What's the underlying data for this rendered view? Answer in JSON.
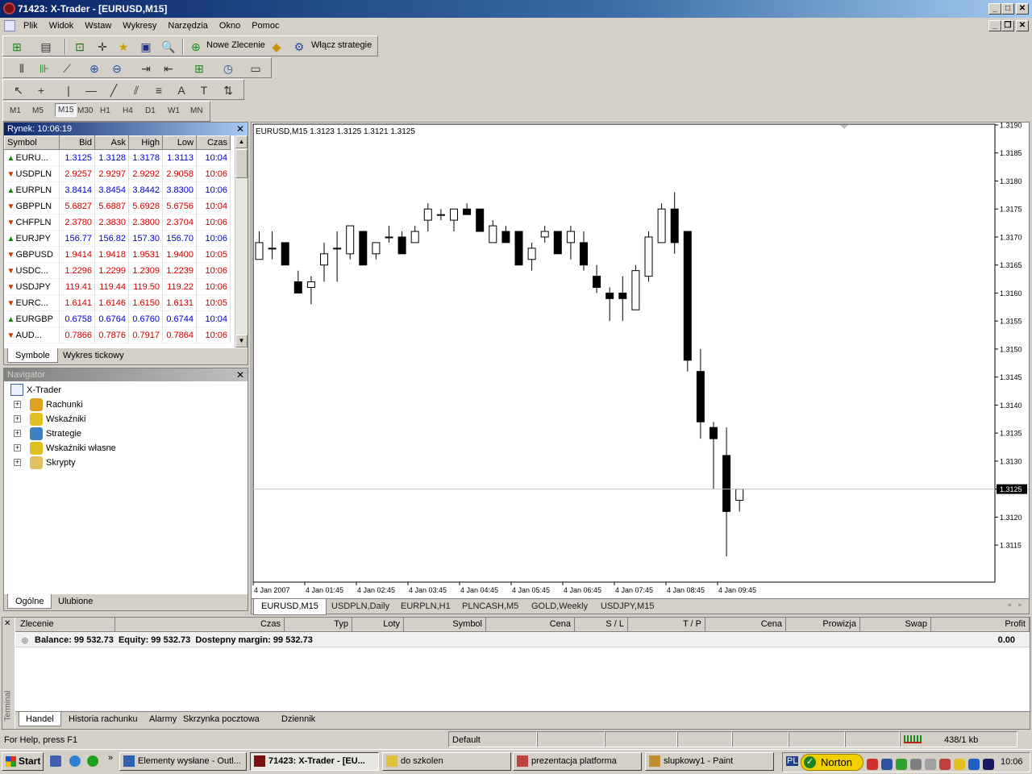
{
  "window": {
    "title": "71423: X-Trader - [EURUSD,M15]"
  },
  "menu": [
    "Plik",
    "Widok",
    "Wstaw",
    "Wykresy",
    "Narzędzia",
    "Okno",
    "Pomoc"
  ],
  "toolbar": {
    "new_order": "Nowe Zlecenie",
    "enable_strategies": "Włącz strategie"
  },
  "timeframes": [
    "M1",
    "M5",
    "M15",
    "M30",
    "H1",
    "H4",
    "D1",
    "W1",
    "MN"
  ],
  "active_timeframe": "M15",
  "market_watch": {
    "title": "Rynek: 10:06:19",
    "columns": [
      "Symbol",
      "Bid",
      "Ask",
      "High",
      "Low",
      "Czas"
    ],
    "rows": [
      {
        "symbol": "EURU...",
        "bid": "1.3125",
        "ask": "1.3128",
        "high": "1.3178",
        "low": "1.3113",
        "time": "10:04",
        "dir": "up"
      },
      {
        "symbol": "USDPLN",
        "bid": "2.9257",
        "ask": "2.9297",
        "high": "2.9292",
        "low": "2.9058",
        "time": "10:06",
        "dir": "down"
      },
      {
        "symbol": "EURPLN",
        "bid": "3.8414",
        "ask": "3.8454",
        "high": "3.8442",
        "low": "3.8300",
        "time": "10:06",
        "dir": "up"
      },
      {
        "symbol": "GBPPLN",
        "bid": "5.6827",
        "ask": "5.6887",
        "high": "5.6928",
        "low": "5.6756",
        "time": "10:04",
        "dir": "down"
      },
      {
        "symbol": "CHFPLN",
        "bid": "2.3780",
        "ask": "2.3830",
        "high": "2.3800",
        "low": "2.3704",
        "time": "10:06",
        "dir": "down"
      },
      {
        "symbol": "EURJPY",
        "bid": "156.77",
        "ask": "156.82",
        "high": "157.30",
        "low": "156.70",
        "time": "10:06",
        "dir": "up"
      },
      {
        "symbol": "GBPUSD",
        "bid": "1.9414",
        "ask": "1.9418",
        "high": "1.9531",
        "low": "1.9400",
        "time": "10:05",
        "dir": "down"
      },
      {
        "symbol": "USDC...",
        "bid": "1.2296",
        "ask": "1.2299",
        "high": "1.2309",
        "low": "1.2239",
        "time": "10:06",
        "dir": "down"
      },
      {
        "symbol": "USDJPY",
        "bid": "119.41",
        "ask": "119.44",
        "high": "119.50",
        "low": "119.22",
        "time": "10:06",
        "dir": "down"
      },
      {
        "symbol": "EURC...",
        "bid": "1.6141",
        "ask": "1.6146",
        "high": "1.6150",
        "low": "1.6131",
        "time": "10:05",
        "dir": "down"
      },
      {
        "symbol": "EURGBP",
        "bid": "0.6758",
        "ask": "0.6764",
        "high": "0.6760",
        "low": "0.6744",
        "time": "10:04",
        "dir": "up"
      },
      {
        "symbol": "AUD...",
        "bid": "0.7866",
        "ask": "0.7876",
        "high": "0.7917",
        "low": "0.7864",
        "time": "10:06",
        "dir": "down"
      }
    ],
    "tabs": [
      "Symbole",
      "Wykres tickowy"
    ]
  },
  "navigator": {
    "title": "Navigator",
    "root": "X-Trader",
    "items": [
      "Rachunki",
      "Wskaźniki",
      "Strategie",
      "Wskaźniki własne",
      "Skrypty"
    ],
    "tabs": [
      "Ogólne",
      "Ulubione"
    ]
  },
  "chart": {
    "header": "EURUSD,M15  1.3123 1.3125 1.3121 1.3125",
    "tabs": [
      "EURUSD,M15",
      "USDPLN,Daily",
      "EURPLN,H1",
      "PLNCASH,M5",
      "GOLD,Weekly",
      "USDJPY,M15"
    ],
    "active_tab": "EURUSD,M15",
    "current_price_label": "1.3125"
  },
  "chart_data": {
    "type": "candlestick",
    "symbol": "EURUSD",
    "timeframe": "M15",
    "current_price": 1.3125,
    "ylim": [
      1.3113,
      1.319
    ],
    "y_ticks": [
      "1.3190",
      "1.3185",
      "1.3180",
      "1.3175",
      "1.3170",
      "1.3165",
      "1.3160",
      "1.3155",
      "1.3150",
      "1.3145",
      "1.3140",
      "1.3135",
      "1.3130",
      "1.3125",
      "1.3120",
      "1.3115"
    ],
    "x_ticks": [
      "4 Jan 2007",
      "4 Jan 01:45",
      "4 Jan 02:45",
      "4 Jan 03:45",
      "4 Jan 04:45",
      "4 Jan 05:45",
      "4 Jan 06:45",
      "4 Jan 07:45",
      "4 Jan 08:45",
      "4 Jan 09:45"
    ],
    "candles": [
      {
        "o": 1.3166,
        "h": 1.3171,
        "l": 1.3166,
        "c": 1.3169
      },
      {
        "o": 1.3168,
        "h": 1.3171,
        "l": 1.3166,
        "c": 1.3168
      },
      {
        "o": 1.3169,
        "h": 1.3169,
        "l": 1.3165,
        "c": 1.3165
      },
      {
        "o": 1.3162,
        "h": 1.3164,
        "l": 1.316,
        "c": 1.316
      },
      {
        "o": 1.3161,
        "h": 1.3163,
        "l": 1.3158,
        "c": 1.3162
      },
      {
        "o": 1.3165,
        "h": 1.3169,
        "l": 1.3162,
        "c": 1.3167
      },
      {
        "o": 1.3168,
        "h": 1.3171,
        "l": 1.3162,
        "c": 1.3168
      },
      {
        "o": 1.3167,
        "h": 1.3172,
        "l": 1.3166,
        "c": 1.3172
      },
      {
        "o": 1.3171,
        "h": 1.3171,
        "l": 1.3165,
        "c": 1.3165
      },
      {
        "o": 1.3167,
        "h": 1.3169,
        "l": 1.3166,
        "c": 1.3169
      },
      {
        "o": 1.317,
        "h": 1.3172,
        "l": 1.3169,
        "c": 1.317
      },
      {
        "o": 1.317,
        "h": 1.3171,
        "l": 1.3167,
        "c": 1.3167
      },
      {
        "o": 1.3169,
        "h": 1.3172,
        "l": 1.3169,
        "c": 1.3171
      },
      {
        "o": 1.3173,
        "h": 1.3176,
        "l": 1.3171,
        "c": 1.3175
      },
      {
        "o": 1.3174,
        "h": 1.3175,
        "l": 1.3173,
        "c": 1.3174
      },
      {
        "o": 1.3173,
        "h": 1.3175,
        "l": 1.3171,
        "c": 1.3175
      },
      {
        "o": 1.3175,
        "h": 1.3176,
        "l": 1.3174,
        "c": 1.3174
      },
      {
        "o": 1.3175,
        "h": 1.3175,
        "l": 1.3171,
        "c": 1.3171
      },
      {
        "o": 1.3169,
        "h": 1.3173,
        "l": 1.3169,
        "c": 1.3172
      },
      {
        "o": 1.3171,
        "h": 1.3172,
        "l": 1.3169,
        "c": 1.3169
      },
      {
        "o": 1.3171,
        "h": 1.3171,
        "l": 1.3165,
        "c": 1.3165
      },
      {
        "o": 1.3166,
        "h": 1.3169,
        "l": 1.3164,
        "c": 1.3168
      },
      {
        "o": 1.317,
        "h": 1.3172,
        "l": 1.3169,
        "c": 1.3171
      },
      {
        "o": 1.3171,
        "h": 1.3171,
        "l": 1.3167,
        "c": 1.3167
      },
      {
        "o": 1.3169,
        "h": 1.3172,
        "l": 1.3166,
        "c": 1.3171
      },
      {
        "o": 1.3169,
        "h": 1.3171,
        "l": 1.3164,
        "c": 1.3165
      },
      {
        "o": 1.3163,
        "h": 1.3165,
        "l": 1.316,
        "c": 1.3161
      },
      {
        "o": 1.316,
        "h": 1.3161,
        "l": 1.3155,
        "c": 1.3159
      },
      {
        "o": 1.316,
        "h": 1.3163,
        "l": 1.3155,
        "c": 1.3159
      },
      {
        "o": 1.3157,
        "h": 1.3165,
        "l": 1.3157,
        "c": 1.3164
      },
      {
        "o": 1.3163,
        "h": 1.3171,
        "l": 1.3162,
        "c": 1.317
      },
      {
        "o": 1.3169,
        "h": 1.3176,
        "l": 1.3169,
        "c": 1.3175
      },
      {
        "o": 1.3175,
        "h": 1.3178,
        "l": 1.3167,
        "c": 1.3169
      },
      {
        "o": 1.3171,
        "h": 1.3171,
        "l": 1.3146,
        "c": 1.3148
      },
      {
        "o": 1.3146,
        "h": 1.315,
        "l": 1.3134,
        "c": 1.3137
      },
      {
        "o": 1.3136,
        "h": 1.3137,
        "l": 1.3125,
        "c": 1.3134
      },
      {
        "o": 1.3131,
        "h": 1.3136,
        "l": 1.3113,
        "c": 1.3121
      },
      {
        "o": 1.3123,
        "h": 1.3125,
        "l": 1.3121,
        "c": 1.3125
      }
    ]
  },
  "terminal": {
    "side_label": "Terminal",
    "columns": [
      "Zlecenie",
      "Czas",
      "Typ",
      "Loty",
      "Symbol",
      "Cena",
      "S / L",
      "T / P",
      "Cena",
      "Prowizja",
      "Swap",
      "Profit"
    ],
    "balance_line": "Balance: 99 532.73  Equity: 99 532.73  Dostepny margin: 99 532.73",
    "profit": "0.00",
    "tabs": [
      "Handel",
      "Historia rachunku",
      "Alarmy",
      "Skrzynka pocztowa",
      "Dziennik"
    ]
  },
  "statusbar": {
    "help": "For Help, press F1",
    "profile": "Default",
    "traffic": "438/1 kb"
  },
  "taskbar": {
    "start": "Start",
    "buttons": [
      "Elementy wysłane - Outl...",
      "71423: X-Trader - [EU...",
      "do szkolen",
      "prezentacja platforma",
      "slupkowy1 - Paint"
    ],
    "active_index": 1,
    "lang": "PL",
    "norton": "Norton",
    "clock": "10:06"
  },
  "colors": {
    "up": "#0000cc",
    "down": "#cc0000",
    "title_active": "#0a246a",
    "chart_bg": "#ffffff",
    "candle": "#000000"
  }
}
